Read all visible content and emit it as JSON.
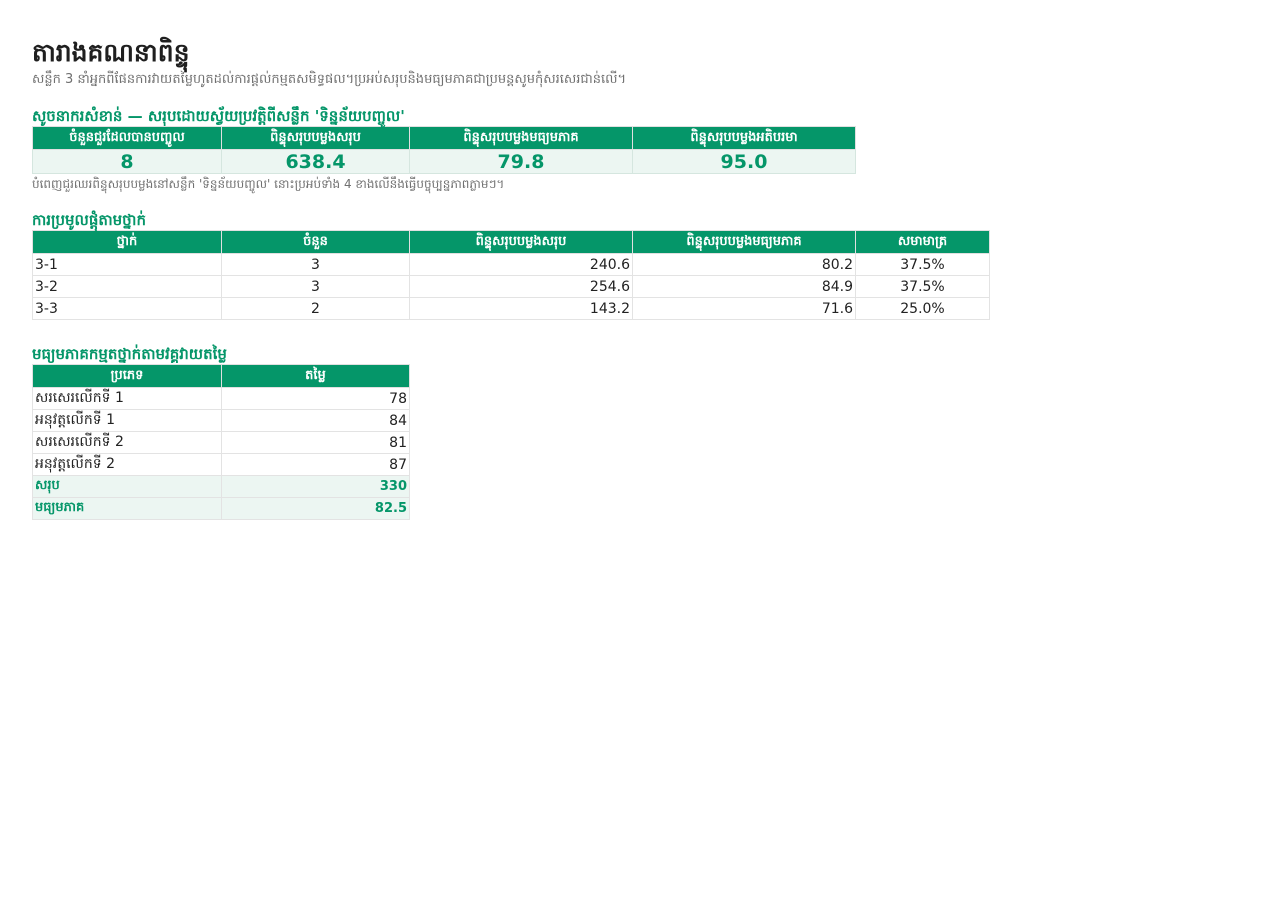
{
  "page": {
    "title": "តារាងគណនាពិន្ទុ",
    "subtitle": "សន្លឹក 3 នាំអ្នកពីផែនការវាយតម្លៃហូតដល់ការផ្តល់កម្មតសមិទ្ធផល។ប្រអប់សរុបនិងមធ្យមភាគជាប្រមន្តសូមកុំសរសេរជាន់លើ។"
  },
  "summary": {
    "title": "សូចនាករសំខាន់ — សរុបដោយស្វ័យប្រវត្តិពីសន្លឹក 'ទិន្នន័យបញ្ចូល'",
    "headers": [
      "ចំនួនជួរដែលបានបញ្ចូល",
      "ពិន្ទុសរុបបម្លងសរុប",
      "ពិន្ទុសរុបបម្លងមធ្យមភាគ",
      "ពិន្ទុសរុបបម្លងអតិបរមា"
    ],
    "values": [
      "8",
      "638.4",
      "79.8",
      "95.0"
    ],
    "note": "បំពេញជួរឈរពិន្ទុសរុបបម្លងនៅសន្លឹក 'ទិន្នន័យបញ្ចូល' នោះប្រអប់ទាំង 4 ខាងលើនឹងធ្វើបច្ចុប្បន្នភាពភ្លាមៗ។"
  },
  "by_class": {
    "title": "ការប្រមូលផ្តុំតាមថ្នាក់",
    "headers": [
      "ថ្នាក់",
      "ចំនួន",
      "ពិន្ទុសរុបបម្លងសរុប",
      "ពិន្ទុសរុបបម្លងមធ្យមភាគ",
      "សមាមាត្រ"
    ],
    "rows": [
      [
        "3-1",
        "3",
        "240.6",
        "80.2",
        "37.5%"
      ],
      [
        "3-2",
        "3",
        "254.6",
        "84.9",
        "37.5%"
      ],
      [
        "3-3",
        "2",
        "143.2",
        "71.6",
        "25.0%"
      ]
    ]
  },
  "by_type": {
    "title": "មធ្យមភាគកម្មតថ្នាក់តាមវគ្គវាយតម្លៃ",
    "headers": [
      "ប្រភេទ",
      "តម្លៃ"
    ],
    "rows": [
      [
        "សរសេរលើកទី 1",
        "78"
      ],
      [
        "អនុវត្តលើកទី 1",
        "84"
      ],
      [
        "សរសេរលើកទី 2",
        "81"
      ],
      [
        "អនុវត្តលើកទី 2",
        "87"
      ]
    ],
    "total_label": "សរុប",
    "total_value": "330",
    "avg_label": "មធ្យមភាគ",
    "avg_value": "82.5"
  },
  "colors": {
    "accent": "#059669",
    "header_text": "#ffffff",
    "highlight_bg": "#ecf6f2",
    "muted_text": "#707070"
  }
}
